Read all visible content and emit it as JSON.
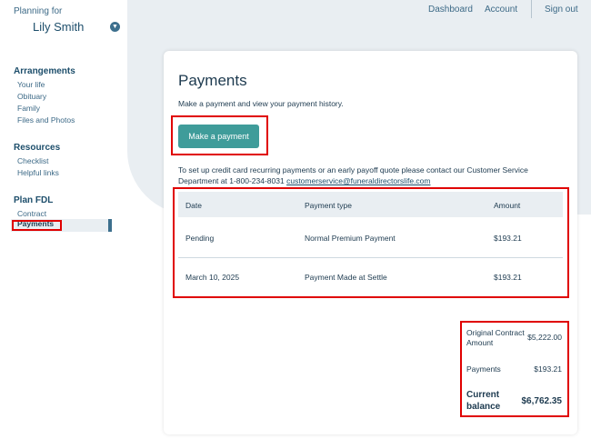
{
  "sidebar": {
    "planning_label": "Planning for",
    "planning_name": "Lily Smith",
    "sections": [
      {
        "title": "Arrangements",
        "items": [
          "Your life",
          "Obituary",
          "Family",
          "Files and Photos"
        ]
      },
      {
        "title": "Resources",
        "items": [
          "Checklist",
          "Helpful links"
        ]
      },
      {
        "title": "Plan FDL",
        "items": [
          "Contract",
          "Payments"
        ]
      }
    ],
    "active_item": "Payments"
  },
  "topnav": {
    "dashboard": "Dashboard",
    "account": "Account",
    "signout": "Sign out"
  },
  "main": {
    "title": "Payments",
    "intro": "Make a payment and view your payment history.",
    "make_payment_label": "Make a payment",
    "contact_text": "To set up credit card recurring payments or an early payoff quote please contact our Customer Service Department at 1-800-234-8031",
    "contact_email": "customerservice@funeraldirectorslife.com",
    "table": {
      "headers": [
        "Date",
        "Payment type",
        "Amount"
      ],
      "rows": [
        [
          "Pending",
          "Normal Premium Payment",
          "$193.21"
        ],
        [
          "March 10, 2025",
          "Payment Made at Settle",
          "$193.21"
        ]
      ]
    },
    "totals": {
      "original_contract_label": "Original Contract Amount",
      "original_contract_value": "$5,222.00",
      "payments_label": "Payments",
      "payments_value": "$193.21",
      "current_balance_label": "Current balance",
      "current_balance_value": "$6,762.35"
    }
  },
  "colors": {
    "accent": "#3f9c9a",
    "highlight": "#e00000",
    "nav_active": "#3c6f8d"
  }
}
